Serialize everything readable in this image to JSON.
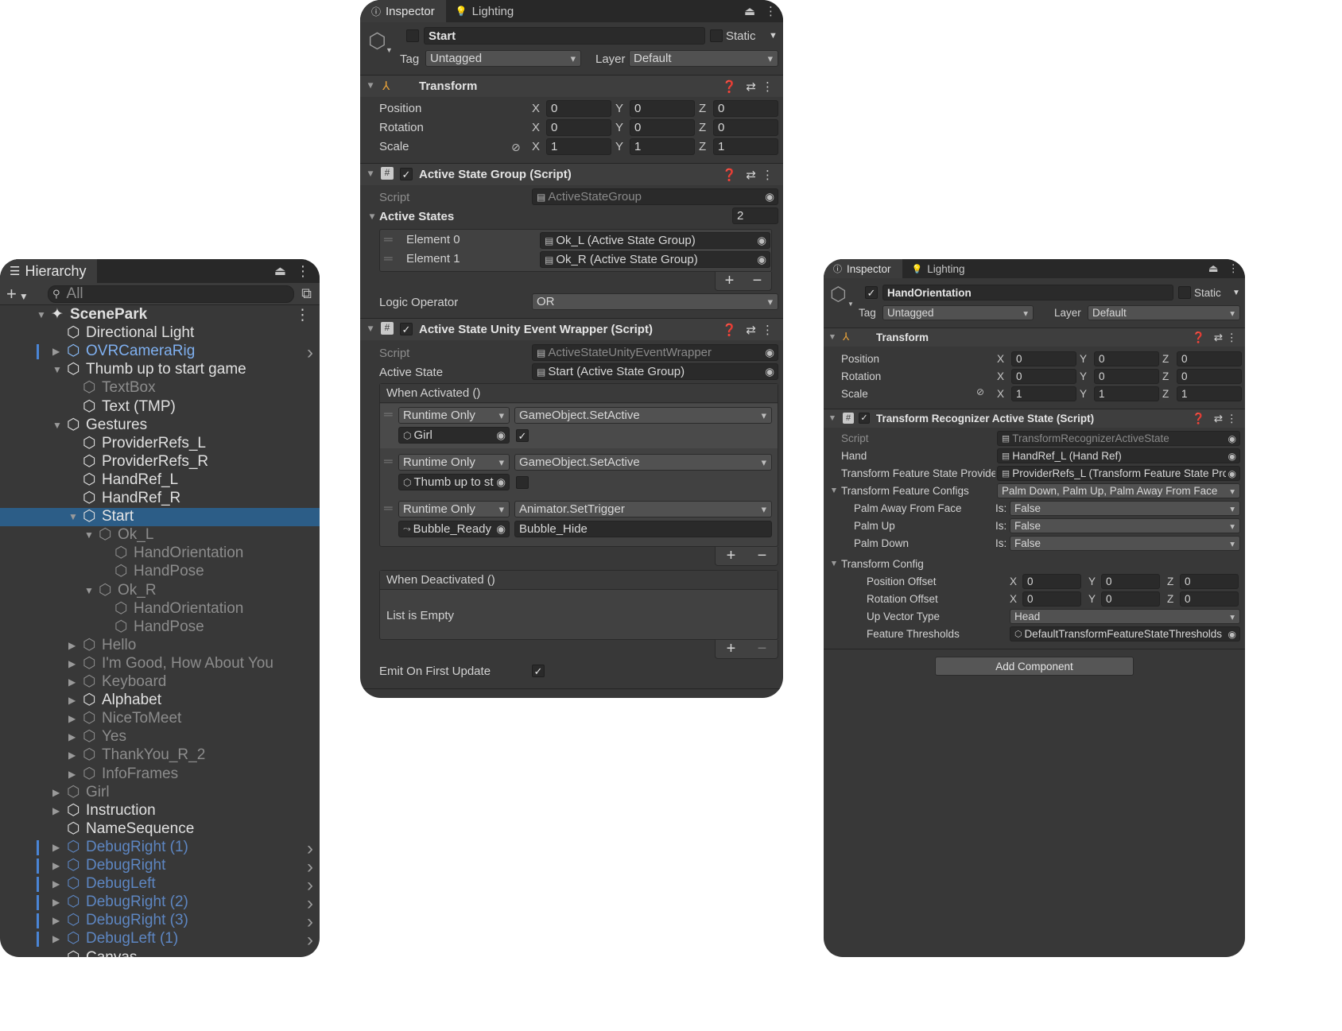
{
  "hierarchy": {
    "tab": "Hierarchy",
    "search_placeholder": "All",
    "items": [
      {
        "name": "ScenePark",
        "depth": 0,
        "expand": "down",
        "style": "scene"
      },
      {
        "name": "Directional Light",
        "depth": 1,
        "expand": "none",
        "style": "normal"
      },
      {
        "name": "OVRCameraRig",
        "depth": 1,
        "expand": "right",
        "style": "prefab-sel"
      },
      {
        "name": "Thumb up to start game",
        "depth": 1,
        "expand": "down",
        "style": "normal"
      },
      {
        "name": "TextBox",
        "depth": 2,
        "expand": "none",
        "style": "dim"
      },
      {
        "name": "Text (TMP)",
        "depth": 2,
        "expand": "none",
        "style": "normal"
      },
      {
        "name": "Gestures",
        "depth": 1,
        "expand": "down",
        "style": "normal"
      },
      {
        "name": "ProviderRefs_L",
        "depth": 2,
        "expand": "none",
        "style": "normal"
      },
      {
        "name": "ProviderRefs_R",
        "depth": 2,
        "expand": "none",
        "style": "normal"
      },
      {
        "name": "HandRef_L",
        "depth": 2,
        "expand": "none",
        "style": "normal"
      },
      {
        "name": "HandRef_R",
        "depth": 2,
        "expand": "none",
        "style": "normal"
      },
      {
        "name": "Start",
        "depth": 2,
        "expand": "down",
        "style": "selected"
      },
      {
        "name": "Ok_L",
        "depth": 3,
        "expand": "down",
        "style": "dim"
      },
      {
        "name": "HandOrientation",
        "depth": 4,
        "expand": "none",
        "style": "dim"
      },
      {
        "name": "HandPose",
        "depth": 4,
        "expand": "none",
        "style": "dim"
      },
      {
        "name": "Ok_R",
        "depth": 3,
        "expand": "down",
        "style": "dim"
      },
      {
        "name": "HandOrientation",
        "depth": 4,
        "expand": "none",
        "style": "dim"
      },
      {
        "name": "HandPose",
        "depth": 4,
        "expand": "none",
        "style": "dim"
      },
      {
        "name": "Hello",
        "depth": 2,
        "expand": "right",
        "style": "dim"
      },
      {
        "name": "I'm Good, How About You",
        "depth": 2,
        "expand": "right",
        "style": "dim"
      },
      {
        "name": "Keyboard",
        "depth": 2,
        "expand": "right",
        "style": "dim"
      },
      {
        "name": "Alphabet",
        "depth": 2,
        "expand": "right",
        "style": "normal"
      },
      {
        "name": "NiceToMeet",
        "depth": 2,
        "expand": "right",
        "style": "dim"
      },
      {
        "name": "Yes",
        "depth": 2,
        "expand": "right",
        "style": "dim"
      },
      {
        "name": "ThankYou_R_2",
        "depth": 2,
        "expand": "right",
        "style": "dim"
      },
      {
        "name": "InfoFrames",
        "depth": 2,
        "expand": "right",
        "style": "dim"
      },
      {
        "name": "Girl",
        "depth": 1,
        "expand": "right",
        "style": "dim"
      },
      {
        "name": "Instruction",
        "depth": 1,
        "expand": "right",
        "style": "normal"
      },
      {
        "name": "NameSequence",
        "depth": 1,
        "expand": "none",
        "style": "normal"
      },
      {
        "name": "DebugRight (1)",
        "depth": 1,
        "expand": "right",
        "style": "prefab-dim"
      },
      {
        "name": "DebugRight",
        "depth": 1,
        "expand": "right",
        "style": "prefab-dim"
      },
      {
        "name": "DebugLeft",
        "depth": 1,
        "expand": "right",
        "style": "prefab-dim"
      },
      {
        "name": "DebugRight (2)",
        "depth": 1,
        "expand": "right",
        "style": "prefab-dim"
      },
      {
        "name": "DebugRight (3)",
        "depth": 1,
        "expand": "right",
        "style": "prefab-dim"
      },
      {
        "name": "DebugLeft (1)",
        "depth": 1,
        "expand": "right",
        "style": "prefab-dim"
      },
      {
        "name": "Canvas",
        "depth": 1,
        "expand": "none",
        "style": "normal"
      }
    ]
  },
  "inspector_start": {
    "tabs": [
      "Inspector",
      "Lighting"
    ],
    "object_name": "Start",
    "static_label": "Static",
    "tag_label": "Tag",
    "tag_value": "Untagged",
    "layer_label": "Layer",
    "layer_value": "Default",
    "transform": {
      "title": "Transform",
      "rows": [
        {
          "label": "Position",
          "x": "0",
          "y": "0",
          "z": "0"
        },
        {
          "label": "Rotation",
          "x": "0",
          "y": "0",
          "z": "0"
        },
        {
          "label": "Scale",
          "x": "1",
          "y": "1",
          "z": "1"
        }
      ]
    },
    "active_state_group": {
      "title": "Active State Group (Script)",
      "script_label": "Script",
      "script_value": "ActiveStateGroup",
      "active_states_label": "Active States",
      "active_states_count": "2",
      "elements": [
        {
          "label": "Element 0",
          "value": "Ok_L (Active State Group)"
        },
        {
          "label": "Element 1",
          "value": "Ok_R (Active State Group)"
        }
      ],
      "logic_operator_label": "Logic Operator",
      "logic_operator_value": "OR"
    },
    "event_wrapper": {
      "title": "Active State Unity Event Wrapper (Script)",
      "script_label": "Script",
      "script_value": "ActiveStateUnityEventWrapper",
      "active_state_label": "Active State",
      "active_state_value": "Start (Active State Group)",
      "when_activated": "When Activated ()",
      "entries": [
        {
          "mode": "Runtime Only",
          "func": "GameObject.SetActive",
          "target": "Girl",
          "arg_type": "check",
          "arg": true
        },
        {
          "mode": "Runtime Only",
          "func": "GameObject.SetActive",
          "target": "Thumb up to st",
          "arg_type": "check",
          "arg": false
        },
        {
          "mode": "Runtime Only",
          "func": "Animator.SetTrigger",
          "target": "Bubble_Ready",
          "arg_type": "text",
          "arg": "Bubble_Hide"
        }
      ],
      "when_deactivated": "When Deactivated ()",
      "list_empty": "List is Empty",
      "emit_label": "Emit On First Update"
    }
  },
  "inspector_hand": {
    "tabs": [
      "Inspector",
      "Lighting"
    ],
    "object_name": "HandOrientation",
    "static_label": "Static",
    "tag_label": "Tag",
    "tag_value": "Untagged",
    "layer_label": "Layer",
    "layer_value": "Default",
    "transform": {
      "title": "Transform",
      "rows": [
        {
          "label": "Position",
          "x": "0",
          "y": "0",
          "z": "0"
        },
        {
          "label": "Rotation",
          "x": "0",
          "y": "0",
          "z": "0"
        },
        {
          "label": "Scale",
          "x": "1",
          "y": "1",
          "z": "1"
        }
      ]
    },
    "recognizer": {
      "title": "Transform Recognizer Active State (Script)",
      "script_label": "Script",
      "script_value": "TransformRecognizerActiveState",
      "hand_label": "Hand",
      "hand_value": "HandRef_L (Hand Ref)",
      "provider_label": "Transform Feature State Provide",
      "provider_value": "ProviderRefs_L (Transform Feature State Prc",
      "configs_label": "Transform Feature Configs",
      "configs_value": "Palm Down, Palm Up, Palm Away From Face",
      "features": [
        {
          "label": "Palm Away From Face",
          "is": "Is:",
          "value": "False"
        },
        {
          "label": "Palm Up",
          "is": "Is:",
          "value": "False"
        },
        {
          "label": "Palm Down",
          "is": "Is:",
          "value": "False"
        }
      ],
      "transform_config_label": "Transform Config",
      "offsets": [
        {
          "label": "Position Offset",
          "x": "0",
          "y": "0",
          "z": "0"
        },
        {
          "label": "Rotation Offset",
          "x": "0",
          "y": "0",
          "z": "0"
        }
      ],
      "up_vector_label": "Up Vector Type",
      "up_vector_value": "Head",
      "thresholds_label": "Feature Thresholds",
      "thresholds_value": "DefaultTransformFeatureStateThresholds"
    },
    "add_component": "Add Component"
  },
  "symbols": {
    "x": "X",
    "y": "Y",
    "z": "Z",
    "plus": "+",
    "minus": "−",
    "help": "?",
    "menu": "⋮",
    "presets": "⇄",
    "check": "✓",
    "lock": "🔓"
  }
}
